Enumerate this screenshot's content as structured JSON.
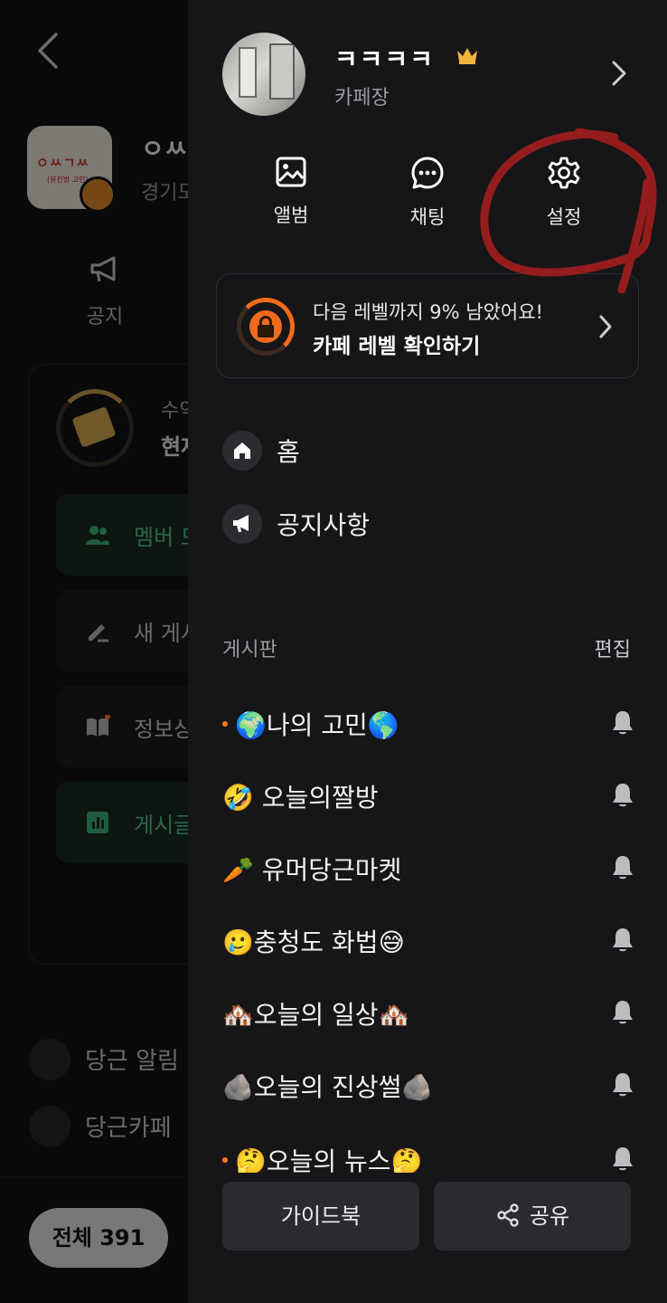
{
  "background": {
    "cafe_name": "ㅇㅆ",
    "cafe_location": "경기도",
    "cafe_logo_text": "ㅇㅆㄱㅆ",
    "cafe_logo_sub": "(유진방 고민)",
    "notice_tab": "공지",
    "level_label": "수익",
    "level_value": "현재",
    "actions": [
      "멤버 모",
      "새 게시",
      "정보상",
      "게시글"
    ],
    "notices": [
      "당근 알림",
      "당근카페"
    ],
    "all_pill": "전체 391"
  },
  "drawer": {
    "profile": {
      "name": "ㅋㅋㅋㅋ",
      "role": "카페장",
      "crown_color": "#f2b33d"
    },
    "quick_actions": [
      {
        "label": "앨범",
        "icon": "album-icon"
      },
      {
        "label": "채팅",
        "icon": "chat-icon"
      },
      {
        "label": "설정",
        "icon": "gear-icon"
      }
    ],
    "level": {
      "progress_text": "다음 레벨까지 9% 남았어요!",
      "cta": "카페 레벨 확인하기",
      "accent": "#f26a1b"
    },
    "menu": [
      {
        "label": "홈",
        "icon": "home-icon"
      },
      {
        "label": "공지사항",
        "icon": "megaphone-icon"
      }
    ],
    "boards_header": "게시판",
    "boards_edit": "편집",
    "boards": [
      {
        "label": "🌍나의 고민🌎",
        "new": true
      },
      {
        "label": "🤣 오늘의짤방",
        "new": false
      },
      {
        "label": "🥕 유머당근마켓",
        "new": false
      },
      {
        "label": "🥲충청도 화법😅",
        "new": false
      },
      {
        "label": "🏘️오늘의 일상🏘️",
        "new": false
      },
      {
        "label": "🪨오늘의 진상썰🪨",
        "new": false
      },
      {
        "label": "🤔오늘의 뉴스🤔",
        "new": true
      }
    ],
    "bottom": {
      "guide": "가이드북",
      "share": "공유"
    }
  },
  "annotation_color": "#9b1c1c"
}
